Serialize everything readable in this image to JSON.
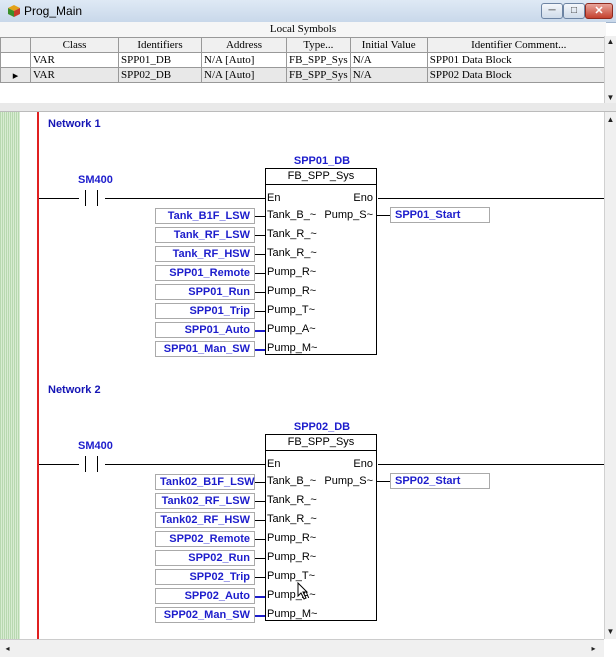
{
  "window": {
    "title": "Prog_Main",
    "minimize_glyph": "─",
    "maximize_glyph": "□",
    "close_glyph": "✕"
  },
  "symbols": {
    "caption": "Local Symbols",
    "columns": [
      "Class",
      "Identifiers",
      "Address",
      "Type...",
      "Initial Value",
      "Identifier Comment..."
    ],
    "rows": [
      {
        "class": "VAR",
        "identifier": "SPP01_DB",
        "address": "N/A [Auto]",
        "type": "FB_SPP_Sys",
        "initial": "N/A",
        "comment": "SPP01 Data Block"
      },
      {
        "class": "VAR",
        "identifier": "SPP02_DB",
        "address": "N/A [Auto]",
        "type": "FB_SPP_Sys",
        "initial": "N/A",
        "comment": "SPP02 Data Block"
      }
    ],
    "selected_marker": "▸"
  },
  "networks": [
    {
      "label": "Network 1",
      "contact": "SM400",
      "instance": "SPP01_DB",
      "fb_type": "FB_SPP_Sys",
      "en": "En",
      "eno": "Eno",
      "inputs": [
        {
          "var": "Tank_B1F_LSW",
          "pin": "Tank_B_~"
        },
        {
          "var": "Tank_RF_LSW",
          "pin": "Tank_R_~"
        },
        {
          "var": "Tank_RF_HSW",
          "pin": "Tank_R_~"
        },
        {
          "var": "SPP01_Remote",
          "pin": "Pump_R~"
        },
        {
          "var": "SPP01_Run",
          "pin": "Pump_R~"
        },
        {
          "var": "SPP01_Trip",
          "pin": "Pump_T~"
        },
        {
          "var": "SPP01_Auto",
          "pin": "Pump_A~"
        },
        {
          "var": "SPP01_Man_SW",
          "pin": "Pump_M~"
        }
      ],
      "output_pin": "Pump_S~",
      "output_var": "SPP01_Start"
    },
    {
      "label": "Network 2",
      "contact": "SM400",
      "instance": "SPP02_DB",
      "fb_type": "FB_SPP_Sys",
      "en": "En",
      "eno": "Eno",
      "inputs": [
        {
          "var": "Tank02_B1F_LSW",
          "pin": "Tank_B_~"
        },
        {
          "var": "Tank02_RF_LSW",
          "pin": "Tank_R_~"
        },
        {
          "var": "Tank02_RF_HSW",
          "pin": "Tank_R_~"
        },
        {
          "var": "SPP02_Remote",
          "pin": "Pump_R~"
        },
        {
          "var": "SPP02_Run",
          "pin": "Pump_R~"
        },
        {
          "var": "SPP02_Trip",
          "pin": "Pump_T~"
        },
        {
          "var": "SPP02_Auto",
          "pin": "Pump_A~"
        },
        {
          "var": "SPP02_Man_SW",
          "pin": "Pump_M~"
        }
      ],
      "output_pin": "Pump_S~",
      "output_var": "SPP02_Start"
    }
  ],
  "scroll": {
    "up": "▲",
    "down": "▼",
    "left": "◂",
    "right": "▸"
  }
}
